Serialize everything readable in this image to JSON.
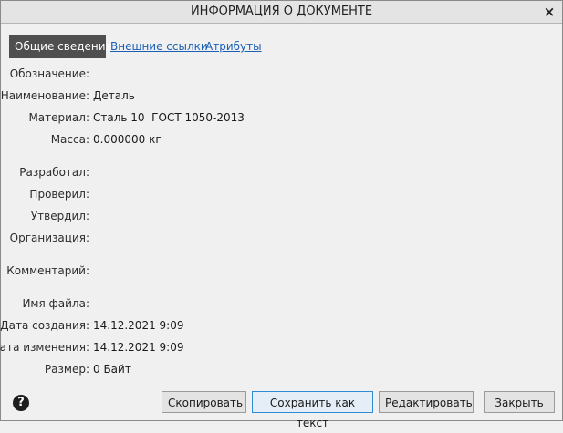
{
  "window": {
    "title": "ИНФОРМАЦИЯ О ДОКУМЕНТЕ",
    "close_label": "×"
  },
  "tabs": [
    {
      "label": "Общие сведения",
      "active": true
    },
    {
      "label": "Внешние ссылки",
      "active": false
    },
    {
      "label": "Атрибуты",
      "active": false
    }
  ],
  "fields": {
    "designation": {
      "label": "Обозначение:",
      "value": ""
    },
    "name": {
      "label": "Наименование:",
      "value": "Деталь"
    },
    "material": {
      "label": "Материал:",
      "value": "Сталь 10  ГОСТ 1050-2013"
    },
    "mass": {
      "label": "Масса:",
      "value": "0.000000 кг"
    },
    "developed": {
      "label": "Разработал:",
      "value": ""
    },
    "checked": {
      "label": "Проверил:",
      "value": ""
    },
    "approved": {
      "label": "Утвердил:",
      "value": ""
    },
    "organization": {
      "label": "Организация:",
      "value": ""
    },
    "comment": {
      "label": "Комментарий:",
      "value": ""
    },
    "filename": {
      "label": "Имя файла:",
      "value": ""
    },
    "created": {
      "label": "Дата создания:",
      "value": "14.12.2021 9:09"
    },
    "modified": {
      "label": "Дата изменения:",
      "value": "14.12.2021 9:09"
    },
    "size": {
      "label": "Размер:",
      "value": "0 Байт"
    }
  },
  "help_icon": "question-circle-icon",
  "help_glyph": "?",
  "buttons": {
    "copy": "Скопировать",
    "save_as_text": "Сохранить как текст",
    "edit": "Редактировать",
    "close": "Закрыть"
  }
}
